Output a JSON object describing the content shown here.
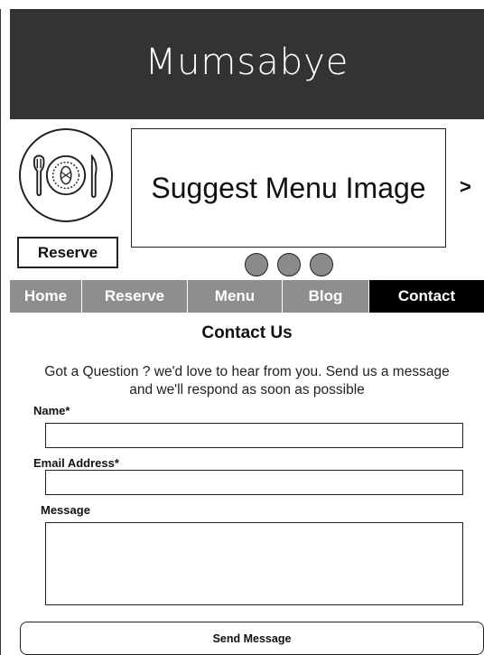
{
  "header": {
    "brand": "Mumsabye"
  },
  "hero": {
    "logo_icon": "plate-fork-knife-icon",
    "reserve_label": "Reserve",
    "image_placeholder": "Suggest Menu Image",
    "next_arrow": ">",
    "carousel_dots": 3
  },
  "nav": {
    "items": [
      {
        "label": "Home",
        "active": false
      },
      {
        "label": "Reserve",
        "active": false
      },
      {
        "label": "Menu",
        "active": false
      },
      {
        "label": "Blog",
        "active": false
      },
      {
        "label": "Contact",
        "active": true
      }
    ]
  },
  "contact": {
    "title": "Contact Us",
    "intro_line1": "Got a Question ? we'd love to  hear from you. Send us a message",
    "intro_line2": "and we'll respond  as soon as possible",
    "name_label": "Name*",
    "name_value": "",
    "email_label": "Email Address*",
    "email_value": "",
    "message_label": "Message",
    "message_value": "",
    "send_label": "Send Message"
  },
  "colors": {
    "header_bg": "#333333",
    "nav_bg": "#8e8e8e",
    "nav_active_bg": "#000000",
    "dot_fill": "#8a8a8a"
  }
}
